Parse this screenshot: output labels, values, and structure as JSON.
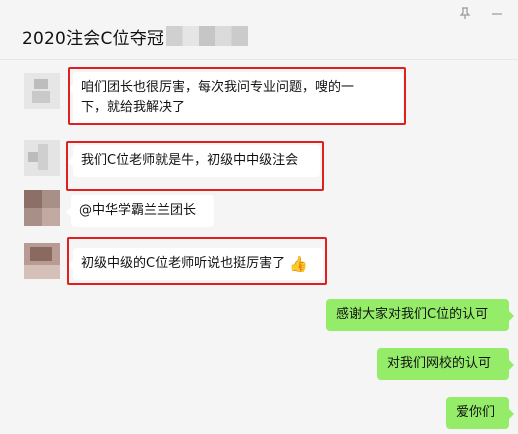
{
  "window": {
    "title": "2020注会C位夺冠",
    "pin_icon": "pin-icon",
    "minimize_icon": "minimize-icon"
  },
  "colors": {
    "incoming_bubble": "#ffffff",
    "outgoing_bubble": "#95ec69",
    "highlight_box": "#e02020",
    "background": "#f5f5f5"
  },
  "messages": [
    {
      "direction": "in",
      "text_line1": "咱们团长也很厉害，每次我问专业问题，嗖的一",
      "text_line2": "下，就给我解决了",
      "highlighted": true
    },
    {
      "direction": "in",
      "text": "我们C位老师就是牛，初级中中级注会",
      "highlighted": true
    },
    {
      "direction": "in",
      "text": "@中华学霸兰兰团长",
      "highlighted": false
    },
    {
      "direction": "in",
      "text": "初级中级的C位老师听说也挺厉害了",
      "emoji": "👍",
      "emoji_name": "thumbs-up-icon",
      "highlighted": true
    },
    {
      "direction": "out",
      "text": "感谢大家对我们C位的认可"
    },
    {
      "direction": "out",
      "text": "对我们网校的认可"
    },
    {
      "direction": "out",
      "text": "爱你们"
    }
  ]
}
